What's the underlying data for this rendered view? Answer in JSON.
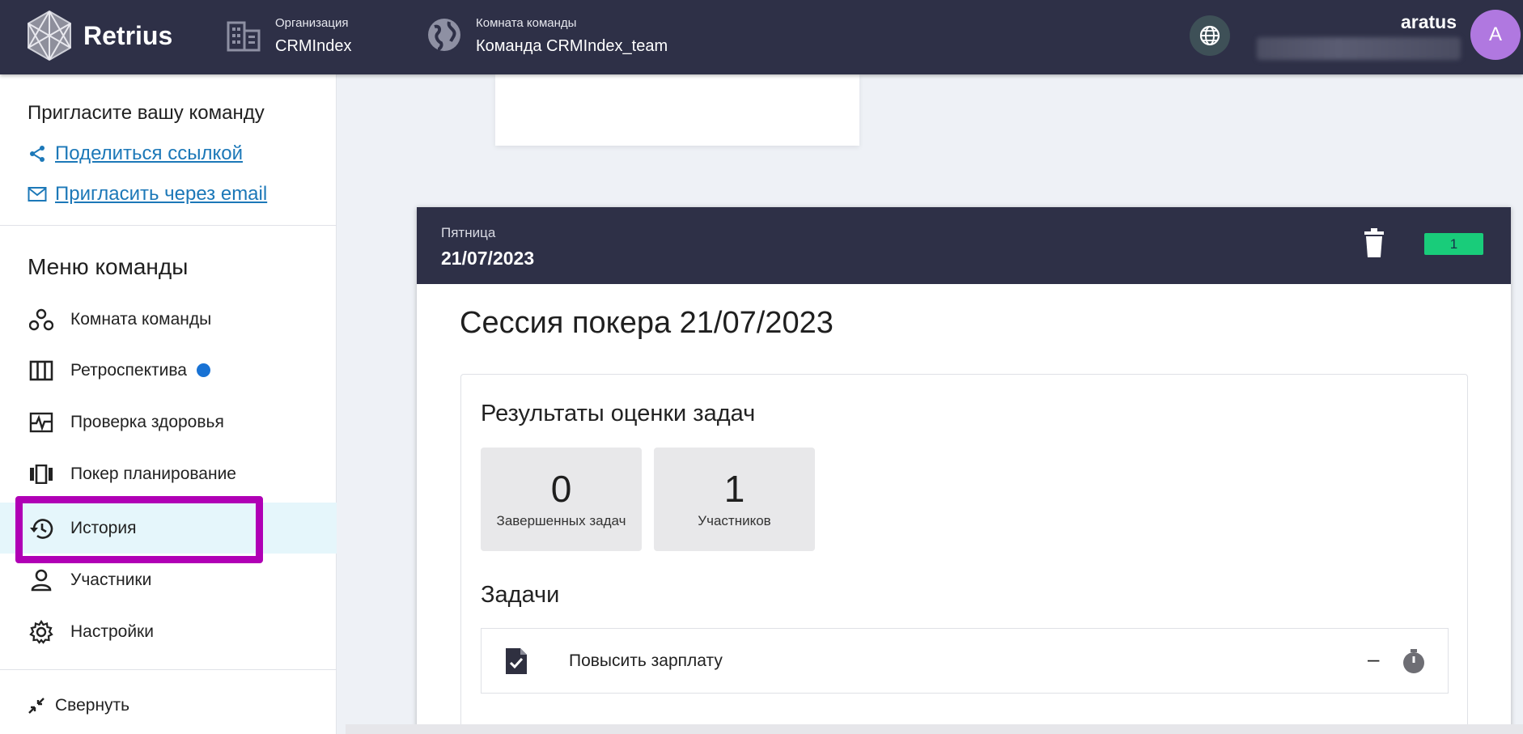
{
  "header": {
    "brand": "Retrius",
    "org_label": "Организация",
    "org_value": "CRMIndex",
    "room_label": "Комната команды",
    "room_value": "Команда CRMIndex_team",
    "username": "aratus",
    "avatar_letter": "A"
  },
  "sidebar": {
    "invite_title": "Пригласите вашу команду",
    "share_link": "Поделиться ссылкой",
    "invite_email": "Пригласить через email",
    "menu_title": "Меню команды",
    "items": [
      {
        "label": "Комната команды",
        "icon": "team-room-icon"
      },
      {
        "label": "Ретроспектива",
        "icon": "retro-columns-icon"
      },
      {
        "label": "Проверка здоровья",
        "icon": "health-check-icon"
      },
      {
        "label": "Покер планирование",
        "icon": "poker-cards-icon"
      },
      {
        "label": "История",
        "icon": "history-icon"
      },
      {
        "label": "Участники",
        "icon": "person-icon"
      },
      {
        "label": "Настройки",
        "icon": "gear-icon"
      }
    ],
    "collapse_label": "Свернуть",
    "active_item": "История",
    "retro_dot_color": "#1872d4"
  },
  "session": {
    "day": "Пятница",
    "date": "21/07/2023",
    "badge": "1",
    "title": "Сессия покера 21/07/2023",
    "results_title": "Результаты оценки задач",
    "stats": [
      {
        "value": "0",
        "label": "Завершенных задач"
      },
      {
        "value": "1",
        "label": "Участников"
      }
    ],
    "tasks_title": "Задачи",
    "tasks": [
      {
        "name": "Повысить зарплату",
        "score": "–"
      }
    ]
  },
  "colors": {
    "header_bg": "#2e3047",
    "badge_bg": "#19cc7a",
    "link": "#1c78b8",
    "highlight": "#b000b5",
    "avatar_bg": "#b078e0"
  }
}
